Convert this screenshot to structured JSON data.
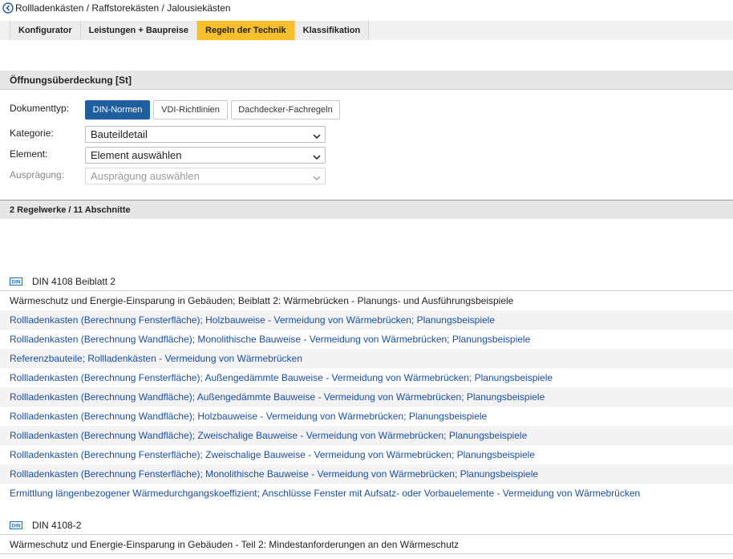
{
  "breadcrumb": {
    "text": "Rollladenkästen / Raffstorekästen / Jalousiekästen"
  },
  "tabs": [
    {
      "label": "Konfigurator"
    },
    {
      "label": "Leistungen + Baupreise"
    },
    {
      "label": "Regeln der Technik"
    },
    {
      "label": "Klassifikation"
    }
  ],
  "active_tab": "Regeln der Technik",
  "section1": {
    "title": "Öffnungsüberdeckung [St]"
  },
  "filters": {
    "doctype_label": "Dokumenttyp:",
    "doctype_buttons": [
      {
        "label": "DIN-Normen"
      },
      {
        "label": "VDI-Richtlinien"
      },
      {
        "label": "Dachdecker-Fachregeln"
      }
    ],
    "kategorie_label": "Kategorie:",
    "kategorie_value": "Bauteildetail",
    "element_label": "Element:",
    "element_value": "Element auswählen",
    "auspraegung_label": "Ausprägung:",
    "auspraegung_value": "Ausprägung auswählen"
  },
  "section2": {
    "title": "2 Regelwerke / 11 Abschnitte"
  },
  "standards": [
    {
      "logo": "DIN",
      "title": "DIN 4108 Beiblatt 2",
      "description": "Wärmeschutz und Energie-Einsparung in Gebäuden; Beiblatt 2: Wärmebrücken - Planungs- und Ausführungsbeispiele",
      "sections": [
        "Rollladenkasten (Berechnung Fensterfläche); Holzbauweise - Vermeidung von Wärmebrücken; Planungsbeispiele",
        "Rollladenkasten (Berechnung Wandfläche); Monolithische Bauweise - Vermeidung von Wärmebrücken; Planungsbeispiele",
        "Referenzbauteile; Rollladenkästen - Vermeidung von Wärmebrücken",
        "Rollladenkasten (Berechnung Fensterfläche); Außengedämmte Bauweise - Vermeidung von Wärmebrücken; Planungsbeispiele",
        "Rollladenkasten (Berechnung Wandfläche); Außengedämmte Bauweise - Vermeidung von Wärmebrücken; Planungsbeispiele",
        "Rollladenkasten (Berechnung Wandfläche); Holzbauweise - Vermeidung von Wärmebrücken; Planungsbeispiele",
        "Rollladenkasten (Berechnung Wandfläche); Zweischalige Bauweise - Vermeidung von Wärmebrücken; Planungsbeispiele",
        "Rollladenkasten (Berechnung Fensterfläche); Zweischalige Bauweise - Vermeidung von Wärmebrücken; Planungsbeispiele",
        "Rollladenkasten (Berechnung Fensterfläche); Monolithische Bauweise - Vermeidung von Wärmebrücken; Planungsbeispiele",
        "Ermittlung längenbezogener Wärmedurchgangskoeffizient; Anschlüsse Fenster mit Aufsatz- oder Vorbauelemente - Vermeidung von Wärmebrücken"
      ]
    },
    {
      "logo": "DIN",
      "title": "DIN 4108-2",
      "description": "Wärmeschutz und Energie-Einsparung in Gebäuden - Teil 2: Mindestanforderungen an den Wärmeschutz",
      "sections": []
    }
  ],
  "colors": {
    "active_tab": "#f5c02c",
    "active_button": "#1f5fa0",
    "link": "#1a4fa3",
    "din_logo": "#1a6fb5"
  }
}
